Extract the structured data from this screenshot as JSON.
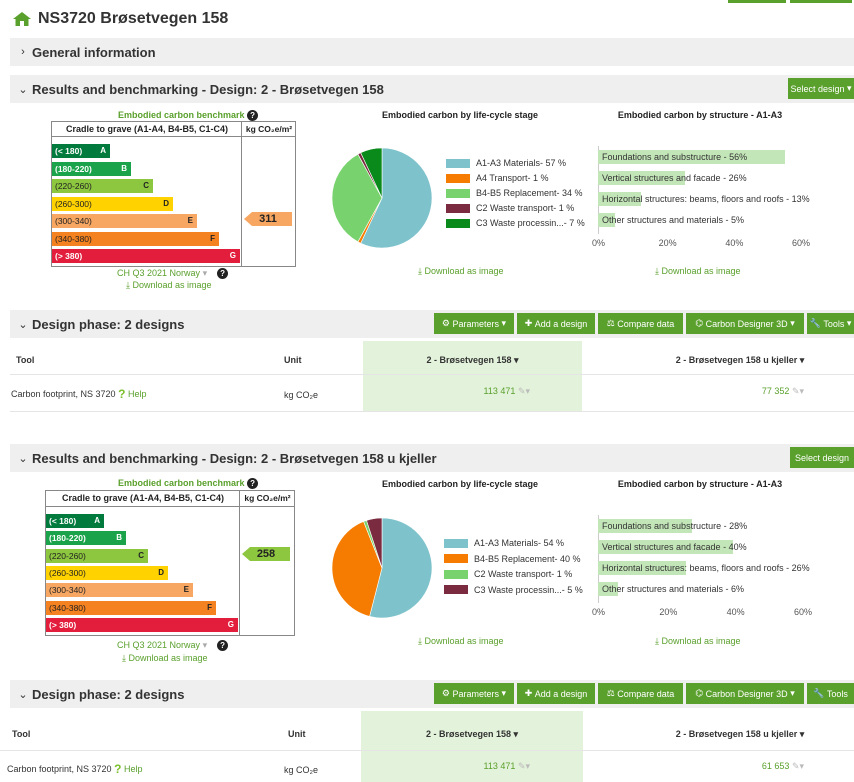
{
  "page_title": "NS3720 Brøsetvegen 158",
  "general_info_label": "General information",
  "results_1": {
    "label": "Results and benchmarking - Design: 2 - Brøsetvegen 158",
    "select_design": "Select design",
    "benchmark_title": "Embodied carbon benchmark",
    "col_scope": "Cradle to grave (A1-A4, B4-B5, C1-C4)",
    "col_unit": "kg CO₂e/m²",
    "bands": [
      {
        "range": "(< 180)",
        "letter": "A",
        "color": "#007a3d"
      },
      {
        "range": "(180-220)",
        "letter": "B",
        "color": "#1aa34a"
      },
      {
        "range": "(220-260)",
        "letter": "C",
        "color": "#8dc63f"
      },
      {
        "range": "(260-300)",
        "letter": "D",
        "color": "#ffd200"
      },
      {
        "range": "(300-340)",
        "letter": "E",
        "color": "#f7a762"
      },
      {
        "range": "(340-380)",
        "letter": "F",
        "color": "#f58220"
      },
      {
        "range": "(> 380)",
        "letter": "G",
        "color": "#e31d3c"
      }
    ],
    "value": "311",
    "value_color": "#f7a762",
    "benchmark_source": "CH Q3 2021 Norway",
    "download_label": "Download as image",
    "lifecycle_title": "Embodied carbon by life-cycle stage",
    "lifecycle_legend": [
      {
        "label": "A1-A3 Materials- 57 %",
        "color": "#7ec3cc"
      },
      {
        "label": "A4 Transport- 1 %",
        "color": "#f57c00"
      },
      {
        "label": "B4-B5 Replacement- 34 %",
        "color": "#78d36e"
      },
      {
        "label": "C2 Waste transport- 1 %",
        "color": "#7b2b3f"
      },
      {
        "label": "C3 Waste processin...- 7 %",
        "color": "#0a8a1a"
      }
    ],
    "structure_title": "Embodied carbon by structure - A1-A3",
    "structure_bars": [
      {
        "label": "Foundations and substructure - 56%",
        "value": 56
      },
      {
        "label": "Vertical structures and facade - 26%",
        "value": 26
      },
      {
        "label": "Horizontal structures: beams, floors and roofs - 13%",
        "value": 13
      },
      {
        "label": "Other structures and materials - 5%",
        "value": 5
      }
    ],
    "axis_ticks": [
      "0%",
      "20%",
      "40%",
      "60%"
    ]
  },
  "design_phase_1": {
    "label": "Design phase: 2 designs",
    "btn_parameters": "Parameters",
    "btn_add": "Add a design",
    "btn_compare": "Compare data",
    "btn_cd3d": "Carbon Designer 3D",
    "btn_tools": "Tools",
    "col_tool": "Tool",
    "col_unit": "Unit",
    "col_design1": "2 - Brøsetvegen 158",
    "col_design2": "2 - Brøsetvegen 158 u kjeller",
    "row_tool": "Carbon footprint, NS 3720",
    "row_help": "Help",
    "row_unit": "kg CO₂e",
    "val_design1": "113 471",
    "val_design2": "77 352"
  },
  "results_2": {
    "label": "Results and benchmarking - Design: 2 - Brøsetvegen 158 u kjeller",
    "select_design": "Select design",
    "benchmark_title": "Embodied carbon benchmark",
    "col_scope": "Cradle to grave (A1-A4, B4-B5, C1-C4)",
    "col_unit": "kg CO₂e/m²",
    "bands": [
      {
        "range": "(< 180)",
        "letter": "A",
        "color": "#007a3d"
      },
      {
        "range": "(180-220)",
        "letter": "B",
        "color": "#1aa34a"
      },
      {
        "range": "(220-260)",
        "letter": "C",
        "color": "#8dc63f"
      },
      {
        "range": "(260-300)",
        "letter": "D",
        "color": "#ffd200"
      },
      {
        "range": "(300-340)",
        "letter": "E",
        "color": "#f7a762"
      },
      {
        "range": "(340-380)",
        "letter": "F",
        "color": "#f58220"
      },
      {
        "range": "(> 380)",
        "letter": "G",
        "color": "#e31d3c"
      }
    ],
    "value": "258",
    "value_color": "#8dc63f",
    "benchmark_source": "CH Q3 2021 Norway",
    "download_label": "Download as image",
    "lifecycle_title": "Embodied carbon by life-cycle stage",
    "lifecycle_legend": [
      {
        "label": "A1-A3 Materials- 54 %",
        "color": "#7ec3cc"
      },
      {
        "label": "B4-B5 Replacement- 40 %",
        "color": "#f57c00"
      },
      {
        "label": "C2 Waste transport- 1 %",
        "color": "#78d36e"
      },
      {
        "label": "C3 Waste processin...- 5 %",
        "color": "#7b2b3f"
      }
    ],
    "structure_title": "Embodied carbon by structure - A1-A3",
    "structure_bars": [
      {
        "label": "Foundations and substructure - 28%",
        "value": 28
      },
      {
        "label": "Vertical structures and facade - 40%",
        "value": 40
      },
      {
        "label": "Horizontal structures: beams, floors and roofs - 26%",
        "value": 26
      },
      {
        "label": "Other structures and materials - 6%",
        "value": 6
      }
    ],
    "axis_ticks": [
      "0%",
      "20%",
      "40%",
      "60%"
    ]
  },
  "design_phase_2": {
    "label": "Design phase: 2 designs",
    "btn_parameters": "Parameters",
    "btn_add": "Add a design",
    "btn_compare": "Compare data",
    "btn_cd3d": "Carbon Designer 3D",
    "btn_tools": "Tools",
    "col_tool": "Tool",
    "col_unit": "Unit",
    "col_design1": "2 - Brøsetvegen 158",
    "col_design2": "2 - Brøsetvegen 158 u kjeller",
    "row_tool": "Carbon footprint, NS 3720",
    "row_help": "Help",
    "row_unit": "kg CO₂e",
    "val_design1": "113 471",
    "val_design2": "61 653"
  }
}
